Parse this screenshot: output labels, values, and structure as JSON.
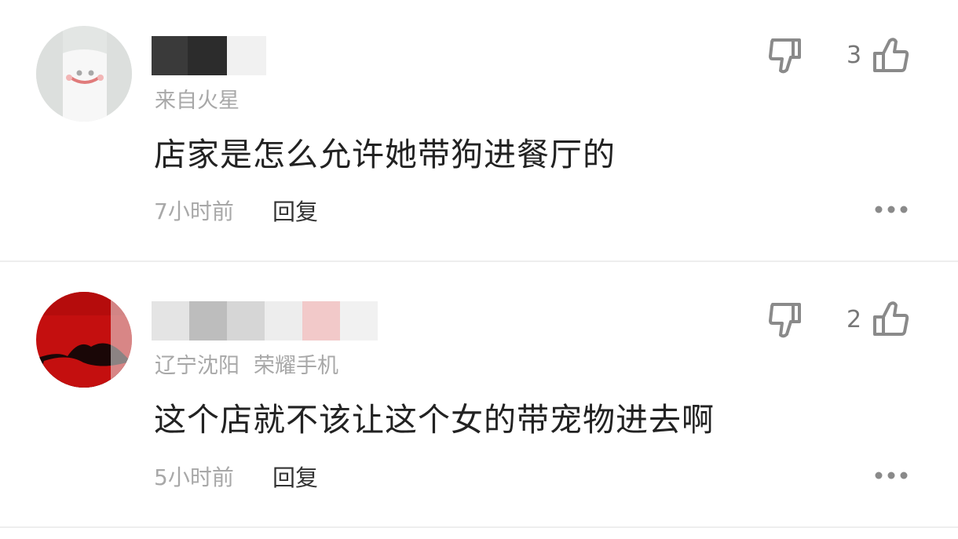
{
  "comments": [
    {
      "location": "来自火星",
      "device": "",
      "text": "店家是怎么允许她带狗进餐厅的",
      "time": "7小时前",
      "reply_label": "回复",
      "likes": "3"
    },
    {
      "location": "辽宁沈阳",
      "device": "荣耀手机",
      "text": "这个店就不该让这个女的带宠物进去啊",
      "time": "5小时前",
      "reply_label": "回复",
      "likes": "2"
    }
  ],
  "icons": {
    "dislike": "thumbs-down-icon",
    "like": "thumbs-up-icon",
    "more": "more-dots-icon"
  },
  "colors": {
    "meta_text": "#a8a8a8",
    "body_text": "#222222",
    "icon": "#8a8a8a",
    "avatar2_red": "#c40f0f"
  }
}
